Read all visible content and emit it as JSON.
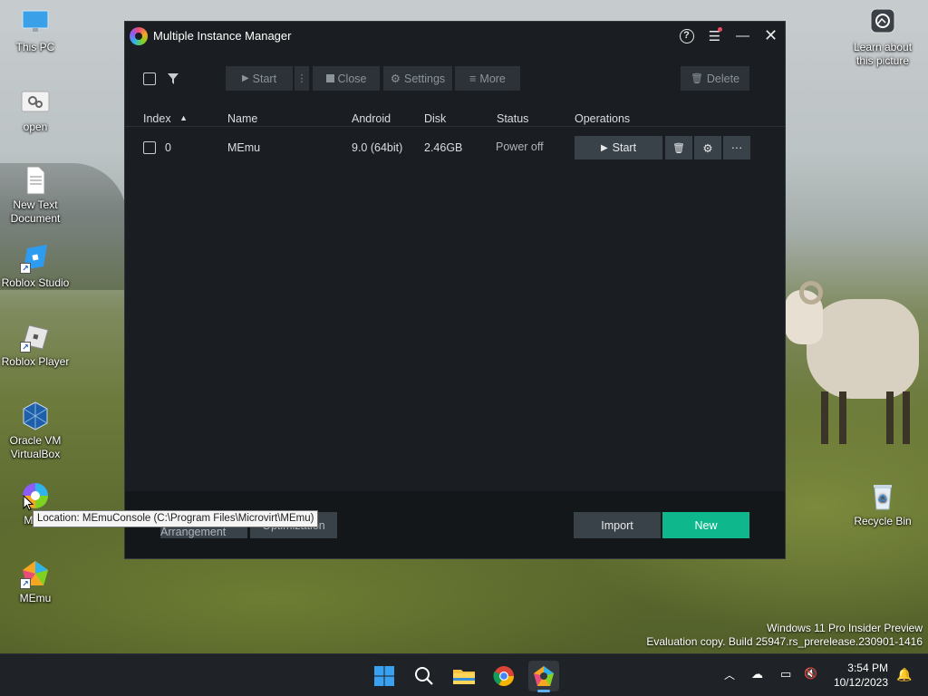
{
  "desktop": {
    "icons": [
      {
        "label": "This PC"
      },
      {
        "label": "open"
      },
      {
        "label": "New Text Document"
      },
      {
        "label": "Roblox Studio"
      },
      {
        "label": "Roblox Player"
      },
      {
        "label": "Oracle VM VirtualBox"
      },
      {
        "label": "Multi"
      },
      {
        "label": "MEmu"
      }
    ],
    "right_icons": [
      {
        "label": "Learn about this picture"
      },
      {
        "label": "Recycle Bin"
      }
    ],
    "tooltip": "Location: MEmuConsole (C:\\Program Files\\Microvirt\\MEmu)",
    "watermark": {
      "line1": "Windows 11 Pro Insider Preview",
      "line2": "Evaluation copy. Build 25947.rs_prerelease.230901-1416"
    }
  },
  "window": {
    "title": "Multiple Instance Manager",
    "toolbar": {
      "start": "Start",
      "close": "Close",
      "settings": "Settings",
      "more": "More",
      "delete": "Delete"
    },
    "columns": {
      "index": "Index",
      "name": "Name",
      "android": "Android",
      "disk": "Disk",
      "status": "Status",
      "operations": "Operations"
    },
    "rows": [
      {
        "index": "0",
        "name": "MEmu",
        "android": "9.0 (64bit)",
        "disk": "2.46GB",
        "status": "Power off",
        "start": "Start"
      }
    ],
    "footer": {
      "left_btn1": "Multi-Arrangement",
      "left_btn2": "Optimization",
      "import": "Import",
      "new": "New"
    }
  },
  "taskbar": {
    "time": "3:54 PM",
    "date": "10/12/2023"
  },
  "colors": {
    "window_bg": "#1a1e22",
    "accent_new": "#0fb88c",
    "button_gray": "#3a4249"
  }
}
